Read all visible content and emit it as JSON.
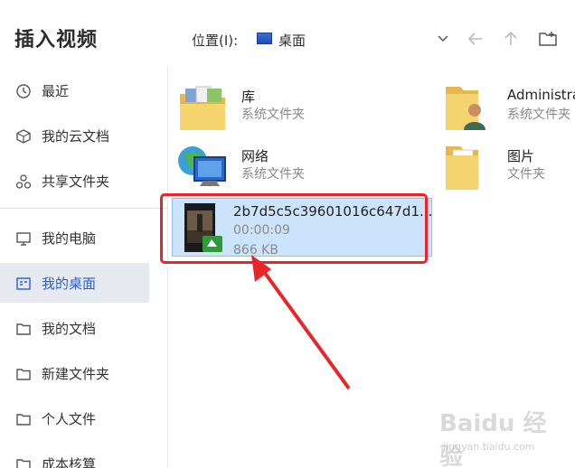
{
  "header": {
    "title": "插入视频",
    "location_label": "位置(I):",
    "location_value": "桌面"
  },
  "sidebar": {
    "items": [
      {
        "label": "最近",
        "icon": "clock-icon"
      },
      {
        "label": "我的云文档",
        "icon": "cloud-doc-icon"
      },
      {
        "label": "共享文件夹",
        "icon": "share-icon"
      },
      {
        "label": "我的电脑",
        "icon": "monitor-icon"
      },
      {
        "label": "我的桌面",
        "icon": "desktop-icon",
        "active": true
      },
      {
        "label": "我的文档",
        "icon": "folder-icon"
      },
      {
        "label": "新建文件夹",
        "icon": "folder-icon"
      },
      {
        "label": "个人文件",
        "icon": "folder-icon"
      },
      {
        "label": "成本核算",
        "icon": "folder-icon"
      }
    ]
  },
  "files": [
    {
      "name": "库",
      "type": "系统文件夹",
      "icon": "library-folder-icon"
    },
    {
      "name": "Administrat",
      "type": "系统文件夹",
      "icon": "user-folder-icon"
    },
    {
      "name": "网络",
      "type": "系统文件夹",
      "icon": "network-icon"
    },
    {
      "name": "图片",
      "type": "文件夹",
      "icon": "folder-icon"
    }
  ],
  "video": {
    "name": "2b7d5c5c39601016c647d1...",
    "duration": "00:00:09",
    "size": "866 KB",
    "icon": "video-thumbnail"
  },
  "watermark": {
    "text": "Baidu 经验",
    "sub": "jingyan.baidu.com"
  },
  "colors": {
    "accent": "#2a5fd4",
    "selection": "#cce4fb",
    "highlight": "#e8262a"
  }
}
